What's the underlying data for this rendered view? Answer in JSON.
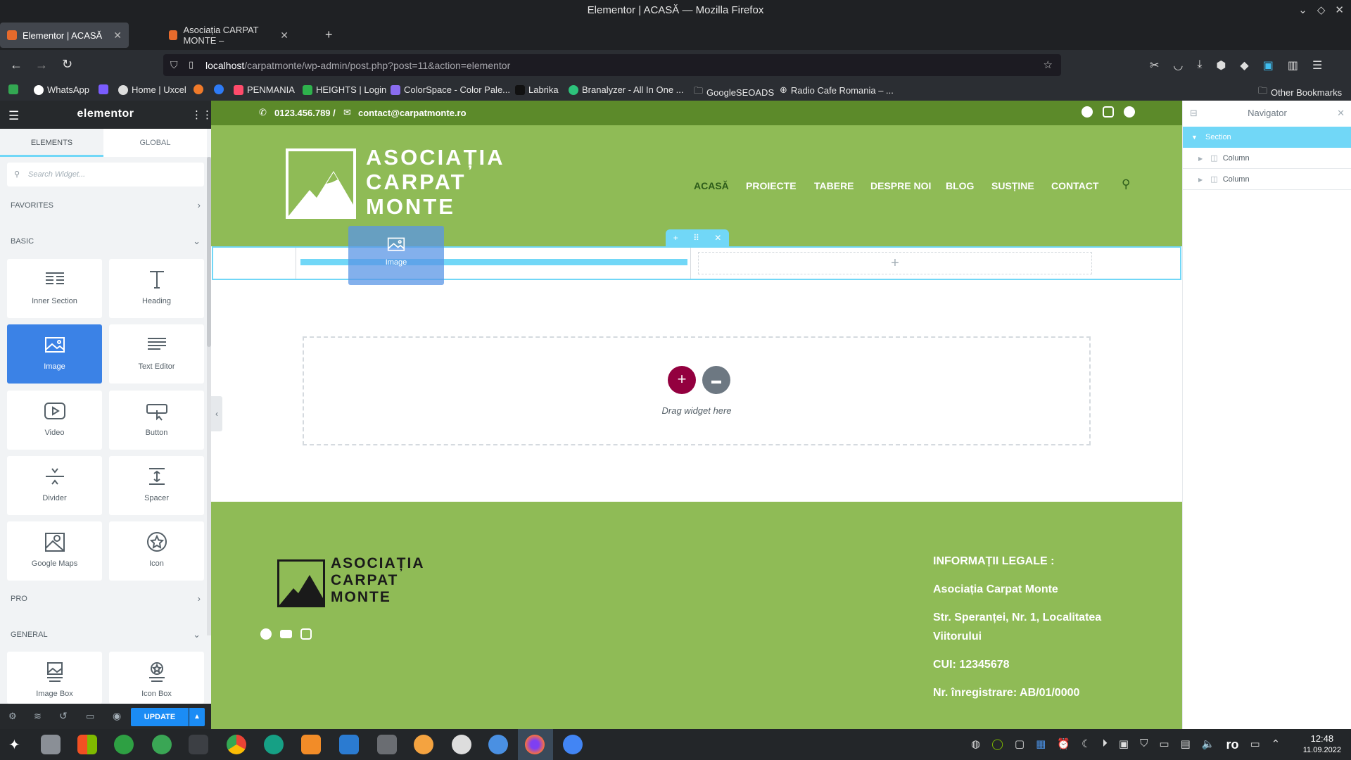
{
  "window": {
    "title": "Elementor | ACASĂ — Mozilla Firefox"
  },
  "tabs": [
    {
      "label": "Elementor | ACASĂ"
    },
    {
      "label": "Asociația CARPAT MONTE –"
    }
  ],
  "url": {
    "host": "localhost",
    "path": "/carpatmonte/wp-admin/post.php?post=11&action=elementor"
  },
  "bookmarks": [
    {
      "label": ""
    },
    {
      "label": "WhatsApp"
    },
    {
      "label": ""
    },
    {
      "label": "Home | Uxcel"
    },
    {
      "label": ""
    },
    {
      "label": ""
    },
    {
      "label": "PENMANIA"
    },
    {
      "label": "HEIGHTS | Login"
    },
    {
      "label": "ColorSpace - Color Pale..."
    },
    {
      "label": "Labrika"
    },
    {
      "label": "Branalyzer - All In One ..."
    },
    {
      "label": "GoogleSEOADS"
    },
    {
      "label": "Radio Cafe Romania – ..."
    }
  ],
  "other_bookmarks": "Other Bookmarks",
  "elementor": {
    "logo": "elementor",
    "tabs": [
      "ELEMENTS",
      "GLOBAL"
    ],
    "search_placeholder": "Search Widget...",
    "categories": {
      "favorites": "FAVORITES",
      "basic": "BASIC",
      "pro": "PRO",
      "general": "GENERAL"
    },
    "widgets": [
      {
        "label": "Inner Section",
        "icon": "inner-section-icon"
      },
      {
        "label": "Heading",
        "icon": "heading-icon"
      },
      {
        "label": "Image",
        "icon": "image-icon"
      },
      {
        "label": "Text Editor",
        "icon": "text-editor-icon"
      },
      {
        "label": "Video",
        "icon": "video-icon"
      },
      {
        "label": "Button",
        "icon": "button-icon"
      },
      {
        "label": "Divider",
        "icon": "divider-icon"
      },
      {
        "label": "Spacer",
        "icon": "spacer-icon"
      },
      {
        "label": "Google Maps",
        "icon": "google-maps-icon"
      },
      {
        "label": "Icon",
        "icon": "star-icon"
      }
    ],
    "general_widgets": [
      {
        "label": "Image Box",
        "icon": "image-box-icon"
      },
      {
        "label": "Icon Box",
        "icon": "icon-box-icon"
      }
    ],
    "update_label": "UPDATE",
    "dragging_label": "Image"
  },
  "site": {
    "phone": "0123.456.789 /",
    "email": "contact@carpatmonte.ro",
    "logo_lines": [
      "ASOCIAȚIA",
      "CARPAT",
      "MONTE"
    ],
    "nav": [
      "ACASĂ",
      "PROIECTE",
      "TABERE",
      "DESPRE NOI",
      "BLOG",
      "SUSȚINE",
      "CONTACT"
    ],
    "drag_text": "Drag widget here",
    "footer_logo_lines": [
      "ASOCIAȚIA",
      "CARPAT",
      "MONTE"
    ],
    "legal": [
      "INFORMAȚII LEGALE :",
      "Asociația Carpat Monte",
      "Str. Speranței, Nr. 1, Localitatea",
      "Viitorului",
      "CUI: 12345678",
      "Nr. înregistrare: AB/01/0000"
    ]
  },
  "navigator": {
    "title": "Navigator",
    "rows": [
      "Section",
      "Column",
      "Column"
    ]
  },
  "taskbar": {
    "time": "12:48",
    "date": "11.09.2022",
    "lang": "ro"
  },
  "colors": {
    "accent": "#71d7f7",
    "brand_green": "#8fbb56",
    "topbar_green": "#5c8a2a",
    "update_blue": "#1b8cf5",
    "add_button": "#93003f"
  }
}
